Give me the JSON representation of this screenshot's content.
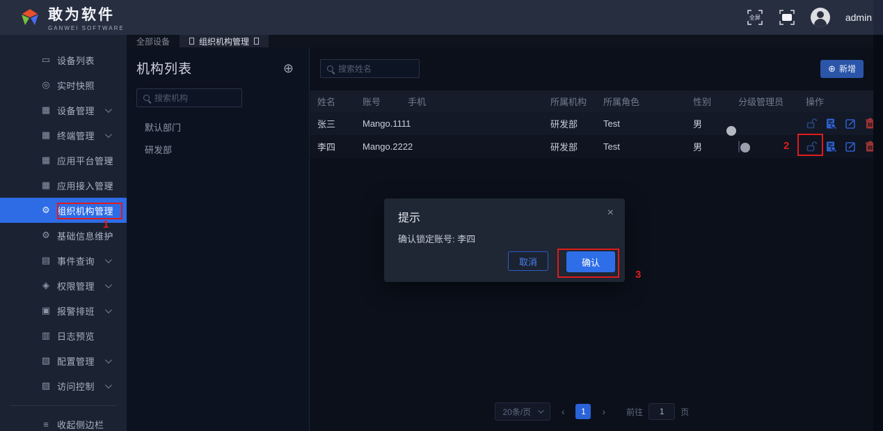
{
  "header": {
    "logo_title": "敢为软件",
    "logo_subtitle": "GANWEI SOFTWARE",
    "fullscreen_label": "全屏",
    "username": "admin"
  },
  "tabs": {
    "all_devices": "全部设备",
    "org_mgmt": "组织机构管理"
  },
  "sidebar": {
    "items": [
      {
        "label": "设备列表",
        "icon": "monitor-icon",
        "glyph": "▭",
        "chevron": false
      },
      {
        "label": "实时快照",
        "icon": "camera-icon",
        "glyph": "◎",
        "chevron": false
      },
      {
        "label": "设备管理",
        "icon": "grid-icon",
        "glyph": "▦",
        "chevron": true
      },
      {
        "label": "终端管理",
        "icon": "grid-icon",
        "glyph": "▦",
        "chevron": true
      },
      {
        "label": "应用平台管理",
        "icon": "grid-icon",
        "glyph": "▦",
        "chevron": true
      },
      {
        "label": "应用接入管理",
        "icon": "grid-icon",
        "glyph": "▦",
        "chevron": true
      },
      {
        "label": "组织机构管理",
        "icon": "gear-icon",
        "glyph": "⚙",
        "chevron": false,
        "active": true
      },
      {
        "label": "基础信息维护",
        "icon": "gear-icon",
        "glyph": "⚙",
        "chevron": true
      },
      {
        "label": "事件查询",
        "icon": "document-icon",
        "glyph": "▤",
        "chevron": true
      },
      {
        "label": "权限管理",
        "icon": "shield-icon",
        "glyph": "◈",
        "chevron": true
      },
      {
        "label": "报警排班",
        "icon": "calendar-icon",
        "glyph": "▣",
        "chevron": true
      },
      {
        "label": "日志预览",
        "icon": "log-icon",
        "glyph": "▥",
        "chevron": false
      },
      {
        "label": "配置管理",
        "icon": "config-icon",
        "glyph": "▧",
        "chevron": true
      },
      {
        "label": "访问控制",
        "icon": "access-icon",
        "glyph": "▨",
        "chevron": true
      }
    ],
    "collapse_label": "收起侧边栏",
    "collapse_glyph": "≡"
  },
  "org_panel": {
    "title": "机构列表",
    "add_icon": "⊕",
    "search_placeholder": "搜索机构",
    "items": [
      "默认部门",
      "研发部"
    ]
  },
  "user_panel": {
    "search_placeholder": "搜索姓名",
    "add_button_label": "新增",
    "add_button_icon": "⊕",
    "table": {
      "columns": [
        "姓名",
        "账号",
        "手机",
        "所属机构",
        "所属角色",
        "性别",
        "分级管理员",
        "操作"
      ],
      "rows": [
        {
          "name": "张三",
          "account": "Mango.1111",
          "phone": "",
          "org": "研发部",
          "role": "Test",
          "gender": "男",
          "admin_toggle": "on"
        },
        {
          "name": "李四",
          "account": "Mango.2222",
          "phone": "",
          "org": "研发部",
          "role": "Test",
          "gender": "男",
          "admin_toggle": "off"
        }
      ]
    },
    "pagination": {
      "page_size": "20条/页",
      "prev": "‹",
      "next": "›",
      "current_page": "1",
      "goto_label": "前往",
      "goto_value": "1",
      "page_unit": "页"
    }
  },
  "modal": {
    "title": "提示",
    "close_icon": "×",
    "message": "确认锁定账号: 李四",
    "cancel_label": "取消",
    "confirm_label": "确认"
  },
  "annotations": {
    "step1": "1",
    "step2": "2",
    "step3": "3",
    "color": "#e01c1c"
  },
  "colors": {
    "accent_blue": "#2e6ce6",
    "confirm_blue": "#2e6ee8",
    "header_bg": "#272e3f",
    "sidebar_bg": "#1b2333",
    "danger_red": "#a33434"
  }
}
